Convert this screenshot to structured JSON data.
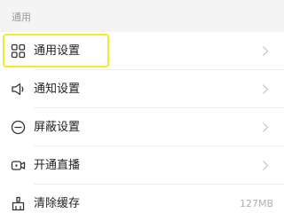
{
  "section": {
    "title": "通用"
  },
  "rows": [
    {
      "label": "通用设置",
      "icon": "grid-icon",
      "accessory": "chevron"
    },
    {
      "label": "通知设置",
      "icon": "speaker-icon",
      "accessory": "chevron"
    },
    {
      "label": "屏蔽设置",
      "icon": "block-icon",
      "accessory": "chevron"
    },
    {
      "label": "开通直播",
      "icon": "live-camera-icon",
      "accessory": "chevron"
    },
    {
      "label": "清除缓存",
      "icon": "clear-cache-icon",
      "value": "127MB"
    }
  ],
  "colors": {
    "section_bg": "#f4f4f4",
    "section_text": "#9a9a9a",
    "row_text": "#222222",
    "icon_stroke": "#333333",
    "chevron": "#c4c4c4",
    "value_text": "#b0b0b0",
    "highlight": "#f4ea2a"
  }
}
